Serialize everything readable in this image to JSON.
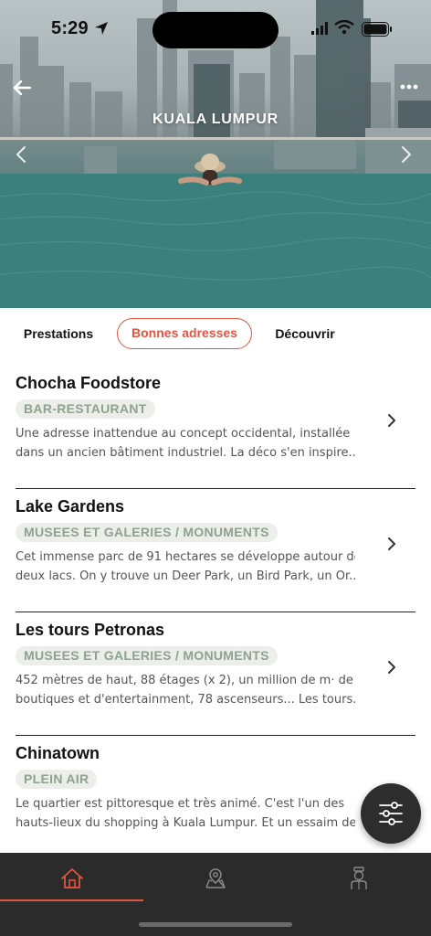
{
  "status_bar": {
    "time": "5:29"
  },
  "header": {
    "title": "KUALA LUMPUR",
    "back_icon": "arrow-left-icon",
    "more_icon": "ellipsis-icon"
  },
  "tabs": [
    {
      "label": "Prestations",
      "active": false
    },
    {
      "label": "Bonnes adresses",
      "active": true
    },
    {
      "label": "Découvrir",
      "active": false
    }
  ],
  "items": [
    {
      "name": "Chocha Foodstore",
      "tag": "BAR-RESTAURANT",
      "desc_line1": "Une adresse inattendue au concept occidental, installée",
      "desc_line2": "dans un ancien bâtiment industriel. La déco s'en inspire..."
    },
    {
      "name": "Lake Gardens",
      "tag": "MUSEES ET GALERIES / MONUMENTS",
      "desc_line1": "Cet immense parc de 91 hectares se développe autour de",
      "desc_line2": "deux lacs. On y trouve un Deer Park, un Bird Park, un Or..."
    },
    {
      "name": "Les tours Petronas",
      "tag": "MUSEES ET GALERIES / MONUMENTS",
      "desc_line1": "452 mètres de haut, 88 étages (x 2), un million de m· de",
      "desc_line2": "boutiques et d'entertainment, 78 ascenseurs... Les tours..."
    },
    {
      "name": "Chinatown",
      "tag": "PLEIN AIR",
      "desc_line1": "Le quartier est pittoresque et très animé. C'est l'un des",
      "desc_line2": "hauts-lieux du shopping à Kuala Lumpur. Et un essaim de..."
    }
  ],
  "fab": {
    "icon": "filter-sliders-icon"
  },
  "bottom_nav": [
    {
      "icon": "home-icon",
      "active": true
    },
    {
      "icon": "map-pin-icon",
      "active": false
    },
    {
      "icon": "concierge-icon",
      "active": false
    }
  ],
  "colors": {
    "accent": "#e2553f",
    "tag_text": "#8ea28e",
    "tag_bg": "#eceeea",
    "nav_bg": "#2b2b2b"
  }
}
